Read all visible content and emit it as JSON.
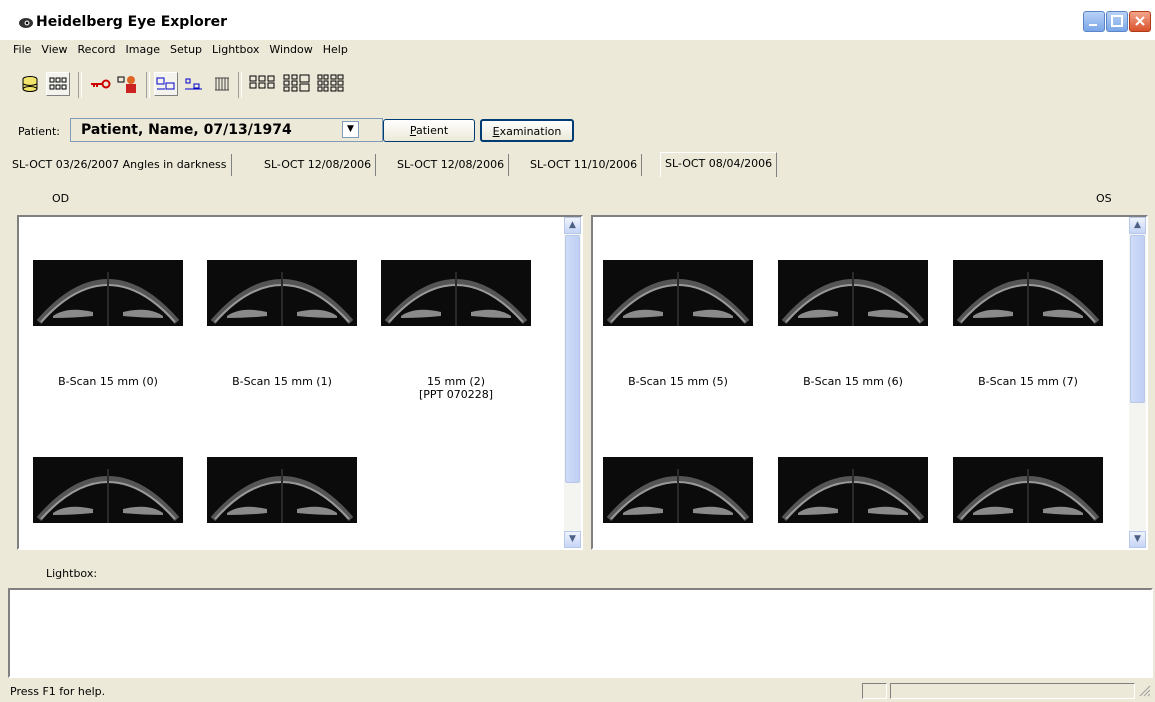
{
  "window": {
    "title": "Heidelberg Eye Explorer"
  },
  "menu": [
    "File",
    "View",
    "Record",
    "Image",
    "Setup",
    "Lightbox",
    "Window",
    "Help"
  ],
  "patient": {
    "label": "Patient:",
    "value": "Patient, Name, 07/13/1974",
    "patient_button": "Patient",
    "examination_button": "Examination"
  },
  "tabs": [
    "SL-OCT 03/26/2007 Angles in darkness",
    "SL-OCT 12/08/2006",
    "SL-OCT 12/08/2006",
    "SL-OCT 11/10/2006",
    "SL-OCT 08/04/2006"
  ],
  "active_tab_index": 4,
  "panes": {
    "od": {
      "header": "OD",
      "captions": [
        [
          "B-Scan 15 mm (0)"
        ],
        [
          "B-Scan 15 mm (1)"
        ],
        [
          "15 mm (2)",
          "[PPT 070228]"
        ]
      ]
    },
    "os": {
      "header": "OS",
      "captions": [
        [
          "B-Scan 15 mm (5)"
        ],
        [
          "B-Scan 15 mm (6)"
        ],
        [
          "B-Scan 15 mm (7)"
        ]
      ]
    }
  },
  "lightbox": {
    "label": "Lightbox:"
  },
  "status": {
    "text": "Press F1 for help."
  },
  "colors": {
    "title_close": "#d9532b",
    "scan_background": "#0b0b0b",
    "window_bg": "#ece9d8"
  }
}
